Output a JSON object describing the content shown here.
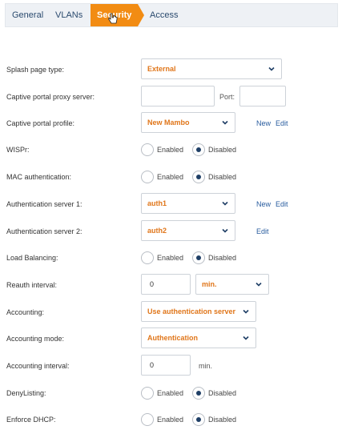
{
  "tabs": [
    "General",
    "VLANs",
    "Security",
    "Access"
  ],
  "active_tab": "Security",
  "radio_labels": {
    "enabled": "Enabled",
    "disabled": "Disabled"
  },
  "form": {
    "splash_page_type": {
      "label": "Splash page type:",
      "value": "External"
    },
    "captive_proxy": {
      "label": "Captive portal proxy server:",
      "value": "",
      "port_label": "Port:",
      "port_value": ""
    },
    "captive_profile": {
      "label": "Captive portal profile:",
      "value": "New Mambo",
      "new": "New",
      "edit": "Edit"
    },
    "wispr": {
      "label": "WISPr:",
      "selected": "Disabled"
    },
    "mac_auth": {
      "label": "MAC authentication:",
      "selected": "Disabled"
    },
    "auth_server_1": {
      "label": "Authentication server 1:",
      "value": "auth1",
      "new": "New",
      "edit": "Edit"
    },
    "auth_server_2": {
      "label": "Authentication server 2:",
      "value": "auth2",
      "edit": "Edit"
    },
    "load_balancing": {
      "label": "Load Balancing:",
      "selected": "Disabled"
    },
    "reauth_interval": {
      "label": "Reauth interval:",
      "value": "0",
      "unit": "min."
    },
    "accounting": {
      "label": "Accounting:",
      "value": "Use authentication server"
    },
    "accounting_mode": {
      "label": "Accounting mode:",
      "value": "Authentication"
    },
    "accounting_interval": {
      "label": "Accounting interval:",
      "value": "0",
      "unit": "min."
    },
    "deny_listing": {
      "label": "DenyListing:",
      "selected": "Disabled"
    },
    "enforce_dhcp": {
      "label": "Enforce DHCP:",
      "selected": "Disabled"
    }
  }
}
